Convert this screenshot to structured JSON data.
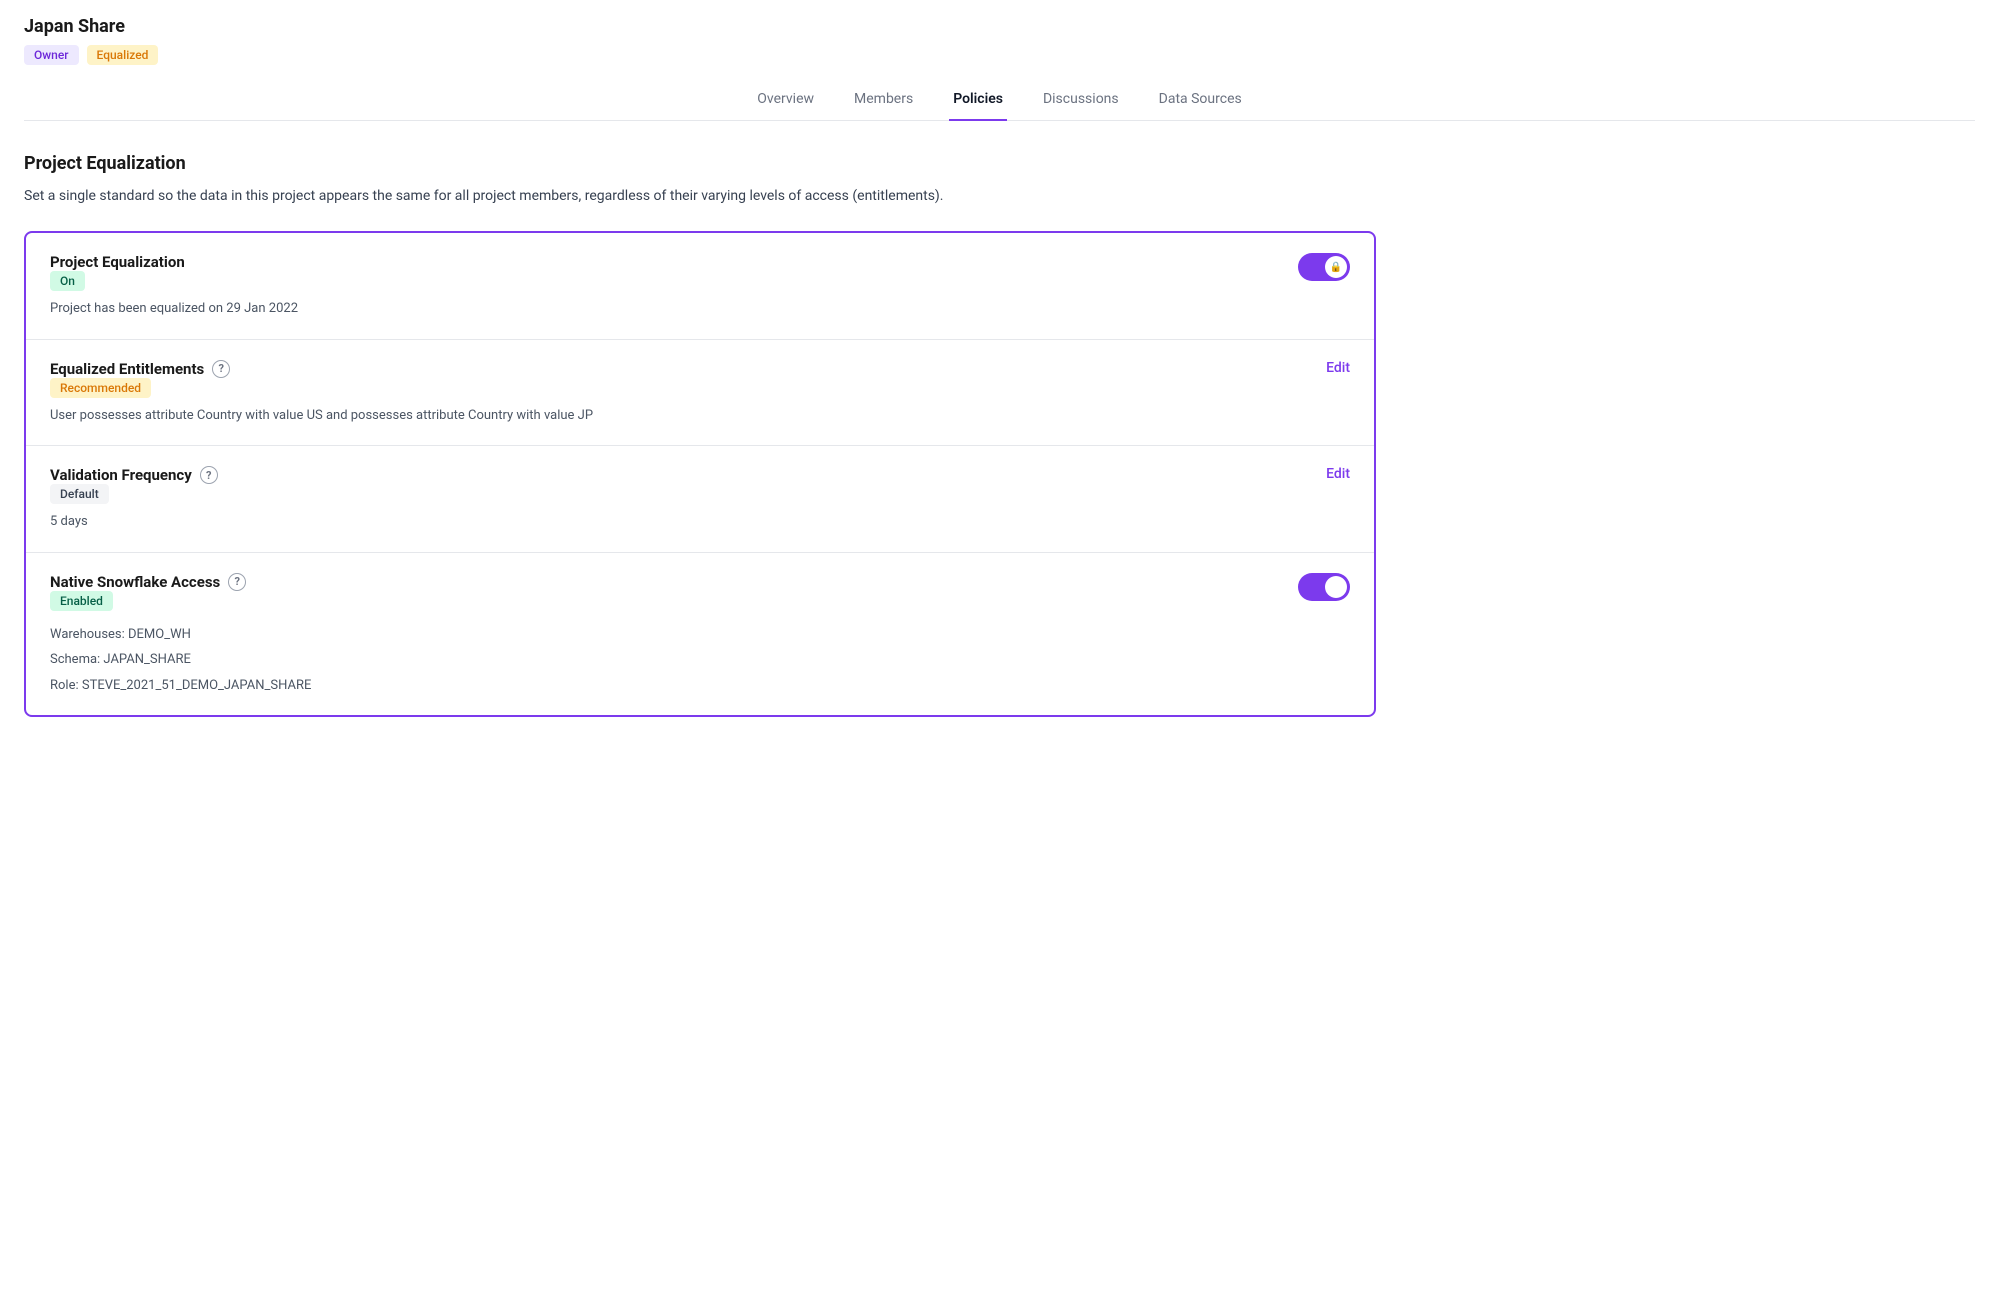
{
  "project": {
    "title": "Japan Share",
    "badges": {
      "owner": "Owner",
      "equalized": "Equalized"
    }
  },
  "nav": {
    "tabs": [
      {
        "id": "overview",
        "label": "Overview",
        "active": false
      },
      {
        "id": "members",
        "label": "Members",
        "active": false
      },
      {
        "id": "policies",
        "label": "Policies",
        "active": true
      },
      {
        "id": "discussions",
        "label": "Discussions",
        "active": false
      },
      {
        "id": "data-sources",
        "label": "Data Sources",
        "active": false
      }
    ]
  },
  "page": {
    "section_title": "Project Equalization",
    "section_description": "Set a single standard so the data in this project appears the same for all project members, regardless of their varying levels of access (entitlements)."
  },
  "policy_card": {
    "rows": [
      {
        "id": "project-equalization",
        "title": "Project Equalization",
        "status_badge": "On",
        "status_type": "on",
        "description": "Project has been equalized on 29 Jan 2022",
        "has_toggle": true,
        "toggle_on": true,
        "has_edit": false,
        "has_help": false
      },
      {
        "id": "equalized-entitlements",
        "title": "Equalized Entitlements",
        "status_badge": "Recommended",
        "status_type": "recommended",
        "description": "User possesses attribute Country with value US and possesses attribute Country with value JP",
        "has_toggle": false,
        "has_edit": true,
        "edit_label": "Edit",
        "has_help": true
      },
      {
        "id": "validation-frequency",
        "title": "Validation Frequency",
        "status_badge": "Default",
        "status_type": "default",
        "description": "5 days",
        "has_toggle": false,
        "has_edit": true,
        "edit_label": "Edit",
        "has_help": true
      },
      {
        "id": "native-snowflake-access",
        "title": "Native Snowflake Access",
        "status_badge": "Enabled",
        "status_type": "enabled",
        "lines": [
          "Warehouses: DEMO_WH",
          "Schema: JAPAN_SHARE",
          "Role: STEVE_2021_51_DEMO_JAPAN_SHARE"
        ],
        "has_toggle": true,
        "toggle_on": true,
        "has_edit": false,
        "has_help": true
      }
    ]
  },
  "icons": {
    "help": "?",
    "lock": "🔒"
  }
}
